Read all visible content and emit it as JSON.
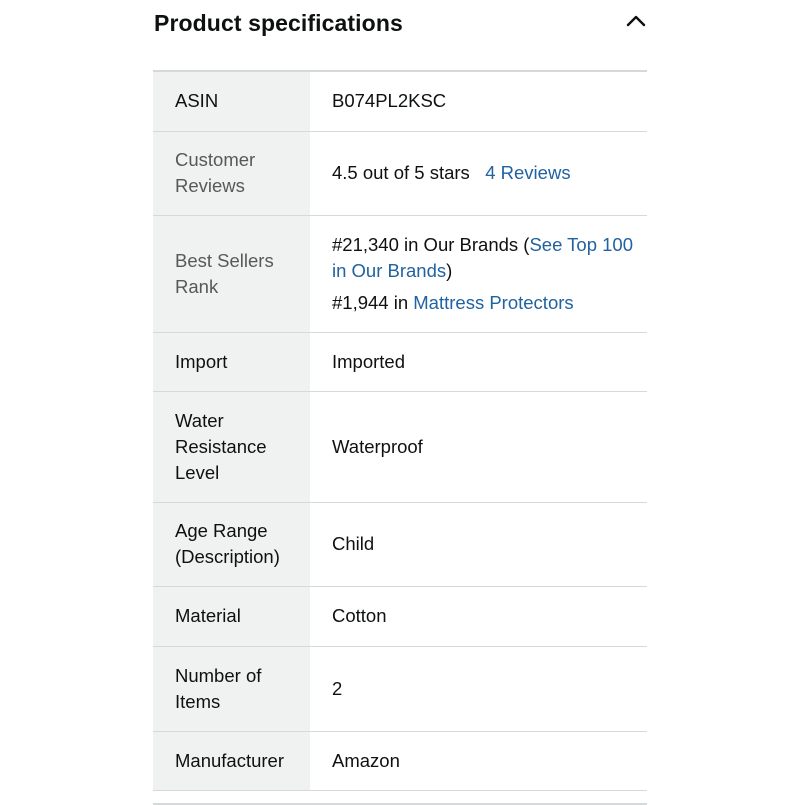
{
  "section": {
    "title": "Product specifications",
    "toggle_icon": "chevron-up-icon"
  },
  "rows": {
    "asin": {
      "label": "ASIN",
      "value": "B074PL2KSC"
    },
    "reviews": {
      "label": "Customer Reviews",
      "rating_text": "4.5 out of 5 stars",
      "reviews_link": "4  Reviews"
    },
    "rank": {
      "label": "Best Sellers Rank",
      "rank1_prefix": "#21,340 in Our Brands (",
      "rank1_link": "See Top 100 in Our Brands",
      "rank1_suffix": ")",
      "rank2_prefix": "#1,944 in ",
      "rank2_link": "Mattress Protectors"
    },
    "import": {
      "label": "Import",
      "value": "Imported"
    },
    "water": {
      "label": "Water Resistance Level",
      "value": "Waterproof"
    },
    "age": {
      "label": "Age Range (Description)",
      "value": "Child"
    },
    "material": {
      "label": "Material",
      "value": "Cotton"
    },
    "items": {
      "label": "Number of Items",
      "value": "2"
    },
    "manufacturer": {
      "label": "Manufacturer",
      "value": "Amazon"
    }
  },
  "colors": {
    "link": "#2162a1",
    "label_bg": "#f0f2f2",
    "divider": "#d5d9d9",
    "text": "#0f1111",
    "muted_text": "#565959"
  }
}
